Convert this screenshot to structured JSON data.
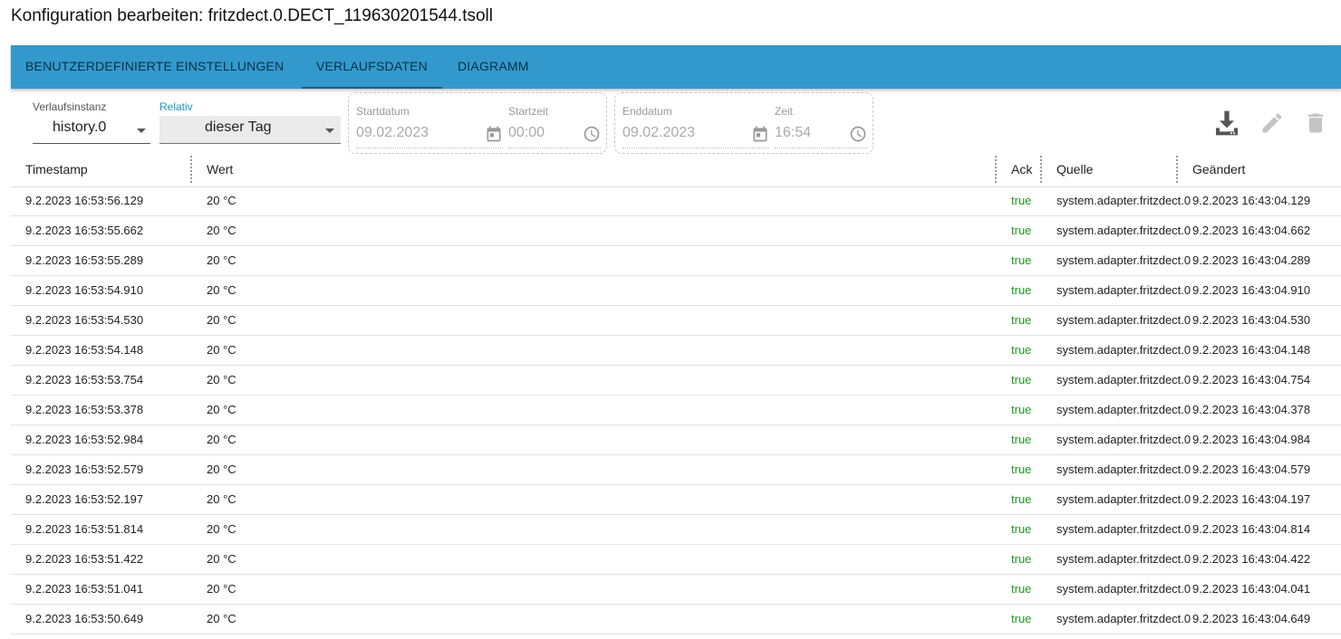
{
  "title": "Konfiguration bearbeiten: fritzdect.0.DECT_119630201544.tsoll",
  "tabs": [
    {
      "label": "BENUTZERDEFINIERTE EINSTELLUNGEN"
    },
    {
      "label": "VERLAUFSDATEN"
    },
    {
      "label": "DIAGRAMM"
    }
  ],
  "active_tab": "VERLAUFSDATEN",
  "controls": {
    "instance": {
      "label": "Verlaufsinstanz",
      "value": "history.0"
    },
    "relative": {
      "label": "Relativ",
      "value": "dieser Tag"
    },
    "start": {
      "date_label": "Startdatum",
      "date_value": "09.02.2023",
      "time_label": "Startzeit",
      "time_value": "00:00"
    },
    "end": {
      "date_label": "Enddatum",
      "date_value": "09.02.2023",
      "time_label": "Zeit",
      "time_value": "16:54"
    }
  },
  "icons": {
    "download": "download-icon",
    "edit": "edit-icon",
    "delete": "trash-icon",
    "calendar": "calendar-icon",
    "clock": "clock-icon"
  },
  "colors": {
    "tab_bar": "#3399cc",
    "ack_true": "#1e9a1e"
  },
  "table": {
    "columns": [
      "Timestamp",
      "Wert",
      "Ack",
      "Quelle",
      "Geändert"
    ],
    "rows": [
      {
        "ts": "9.2.2023 16:53:56.129",
        "val": "20 °C",
        "ack": "true",
        "src": "system.adapter.fritzdect.0",
        "changed": "9.2.2023 16:43:04.129"
      },
      {
        "ts": "9.2.2023 16:53:55.662",
        "val": "20 °C",
        "ack": "true",
        "src": "system.adapter.fritzdect.0",
        "changed": "9.2.2023 16:43:04.662"
      },
      {
        "ts": "9.2.2023 16:53:55.289",
        "val": "20 °C",
        "ack": "true",
        "src": "system.adapter.fritzdect.0",
        "changed": "9.2.2023 16:43:04.289"
      },
      {
        "ts": "9.2.2023 16:53:54.910",
        "val": "20 °C",
        "ack": "true",
        "src": "system.adapter.fritzdect.0",
        "changed": "9.2.2023 16:43:04.910"
      },
      {
        "ts": "9.2.2023 16:53:54.530",
        "val": "20 °C",
        "ack": "true",
        "src": "system.adapter.fritzdect.0",
        "changed": "9.2.2023 16:43:04.530"
      },
      {
        "ts": "9.2.2023 16:53:54.148",
        "val": "20 °C",
        "ack": "true",
        "src": "system.adapter.fritzdect.0",
        "changed": "9.2.2023 16:43:04.148"
      },
      {
        "ts": "9.2.2023 16:53:53.754",
        "val": "20 °C",
        "ack": "true",
        "src": "system.adapter.fritzdect.0",
        "changed": "9.2.2023 16:43:04.754"
      },
      {
        "ts": "9.2.2023 16:53:53.378",
        "val": "20 °C",
        "ack": "true",
        "src": "system.adapter.fritzdect.0",
        "changed": "9.2.2023 16:43:04.378"
      },
      {
        "ts": "9.2.2023 16:53:52.984",
        "val": "20 °C",
        "ack": "true",
        "src": "system.adapter.fritzdect.0",
        "changed": "9.2.2023 16:43:04.984"
      },
      {
        "ts": "9.2.2023 16:53:52.579",
        "val": "20 °C",
        "ack": "true",
        "src": "system.adapter.fritzdect.0",
        "changed": "9.2.2023 16:43:04.579"
      },
      {
        "ts": "9.2.2023 16:53:52.197",
        "val": "20 °C",
        "ack": "true",
        "src": "system.adapter.fritzdect.0",
        "changed": "9.2.2023 16:43:04.197"
      },
      {
        "ts": "9.2.2023 16:53:51.814",
        "val": "20 °C",
        "ack": "true",
        "src": "system.adapter.fritzdect.0",
        "changed": "9.2.2023 16:43:04.814"
      },
      {
        "ts": "9.2.2023 16:53:51.422",
        "val": "20 °C",
        "ack": "true",
        "src": "system.adapter.fritzdect.0",
        "changed": "9.2.2023 16:43:04.422"
      },
      {
        "ts": "9.2.2023 16:53:51.041",
        "val": "20 °C",
        "ack": "true",
        "src": "system.adapter.fritzdect.0",
        "changed": "9.2.2023 16:43:04.041"
      },
      {
        "ts": "9.2.2023 16:53:50.649",
        "val": "20 °C",
        "ack": "true",
        "src": "system.adapter.fritzdect.0",
        "changed": "9.2.2023 16:43:04.649"
      }
    ]
  }
}
